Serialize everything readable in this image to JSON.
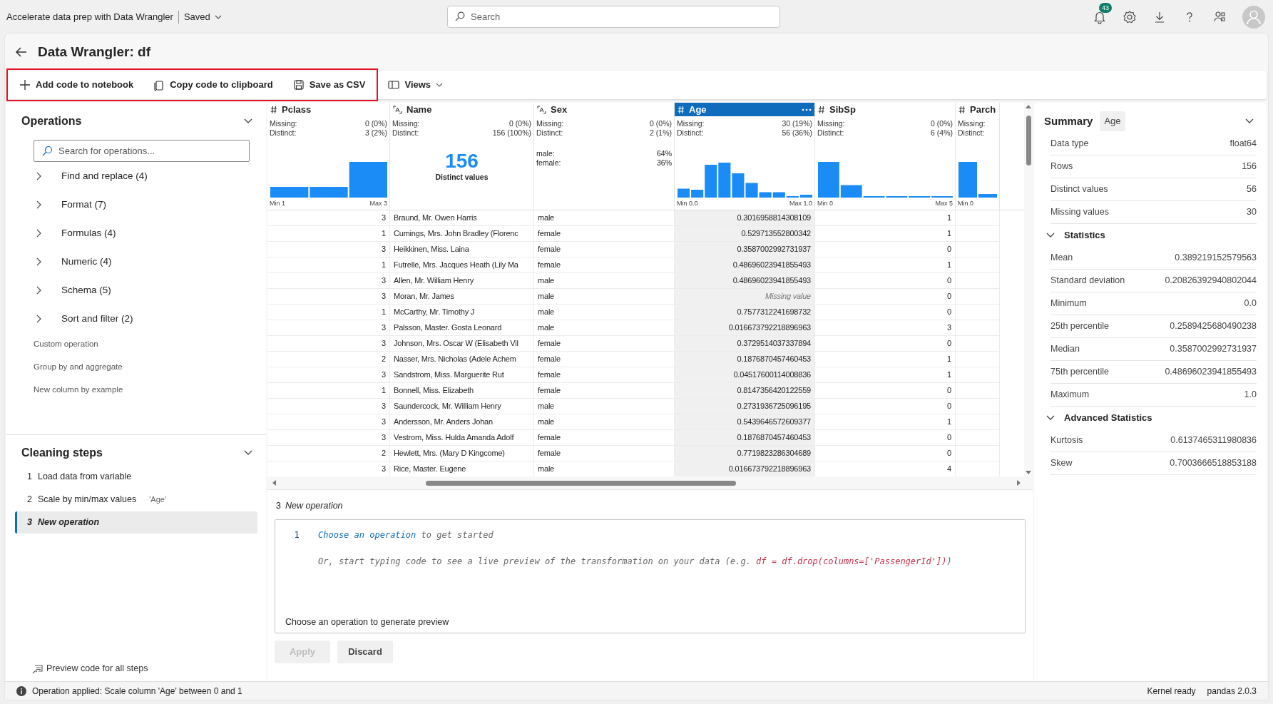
{
  "top_bar": {
    "title": "Accelerate data prep with Data Wrangler",
    "save_state": "Saved",
    "search_placeholder": "Search",
    "notification_count": "43"
  },
  "header": {
    "title": "Data Wrangler: df"
  },
  "toolbar": {
    "highlighted": [
      {
        "kind": "add",
        "label": "Add code to notebook"
      },
      {
        "kind": "copy",
        "label": "Copy code to clipboard"
      },
      {
        "kind": "save",
        "label": "Save as CSV"
      }
    ],
    "other": [
      {
        "kind": "views",
        "label": "Views"
      }
    ]
  },
  "operations": {
    "title": "Operations",
    "expanded": true,
    "search_placeholder": "Search for operations...",
    "items": [
      {
        "kind": "group",
        "label": "Find and replace (4)",
        "expanded": false
      },
      {
        "kind": "group",
        "label": "Format (7)",
        "expanded": false
      },
      {
        "kind": "group",
        "label": "Formulas (4)",
        "expanded": false
      },
      {
        "kind": "group",
        "label": "Numeric (4)",
        "expanded": false
      },
      {
        "kind": "group",
        "label": "Schema (5)",
        "expanded": false
      },
      {
        "kind": "group",
        "label": "Sort and filter (2)",
        "expanded": false
      },
      {
        "kind": "action",
        "label": "Custom operation"
      },
      {
        "kind": "action",
        "label": "Group by and aggregate"
      },
      {
        "kind": "action",
        "label": "New column by example"
      }
    ]
  },
  "cleaning_steps": {
    "title": "Cleaning steps",
    "expanded": true,
    "steps": [
      {
        "number": "1",
        "label": "Load data from variable",
        "selected": false
      },
      {
        "number": "2",
        "label": "Scale by min/max values",
        "tag": "'Age'",
        "selected": false
      },
      {
        "number": "3",
        "label": "New operation",
        "selected": true
      }
    ],
    "preview_link": "Preview code for all steps"
  },
  "table": {
    "columns": [
      {
        "name": "Pclass",
        "kind": "number",
        "selected": false,
        "stats": [
          {
            "label": "Missing:",
            "value": "0 (0%)"
          },
          {
            "label": "Distinct:",
            "value": "3 (2%)"
          }
        ],
        "min": "Min 1",
        "max": "Max 3"
      },
      {
        "name": "Name",
        "kind": "text",
        "selected": false,
        "stats": [
          {
            "label": "Missing:",
            "value": "0 (0%)"
          },
          {
            "label": "Distinct:",
            "value": "156 (100%)"
          }
        ],
        "distinct_count": "156",
        "distinct_caption": "Distinct values"
      },
      {
        "name": "Sex",
        "kind": "text",
        "selected": false,
        "stats": [
          {
            "label": "Missing:",
            "value": "0 (0%)"
          },
          {
            "label": "Distinct:",
            "value": "2 (1%)"
          }
        ],
        "categories": [
          {
            "label": "male:",
            "value": "64%"
          },
          {
            "label": "female:",
            "value": "36%"
          }
        ]
      },
      {
        "name": "Age",
        "kind": "number",
        "selected": true,
        "stats": [
          {
            "label": "Missing:",
            "value": "30 (19%)"
          },
          {
            "label": "Distinct:",
            "value": "56 (36%)"
          }
        ],
        "min": "Min 0.0",
        "max": "Max 1.0"
      },
      {
        "name": "SibSp",
        "kind": "number",
        "selected": false,
        "stats": [
          {
            "label": "Missing:",
            "value": "0 (0%)"
          },
          {
            "label": "Distinct:",
            "value": "6 (4%)"
          }
        ],
        "min": "Min 0",
        "max": "Max 5"
      },
      {
        "name": "Parch",
        "kind": "number",
        "selected": false,
        "stats": [
          {
            "label": "Missing:"
          },
          {
            "label": "Distinct:"
          }
        ],
        "min": "Min 0"
      }
    ],
    "rows": [
      {
        "cells": [
          "3",
          "Braund, Mr. Owen Harris",
          "male",
          "0.3016958814308109",
          "1"
        ],
        "missing": [
          false,
          false,
          false,
          false,
          false
        ]
      },
      {
        "cells": [
          "1",
          "Cumings, Mrs. John Bradley (Florenc",
          "female",
          "0.529713552800342",
          "1"
        ],
        "missing": [
          false,
          false,
          false,
          false,
          false
        ]
      },
      {
        "cells": [
          "3",
          "Heikkinen, Miss. Laina",
          "female",
          "0.3587002992731937",
          "0"
        ],
        "missing": [
          false,
          false,
          false,
          false,
          false
        ]
      },
      {
        "cells": [
          "1",
          "Futrelle, Mrs. Jacques Heath (Lily Ma",
          "female",
          "0.48696023941855493",
          "1"
        ],
        "missing": [
          false,
          false,
          false,
          false,
          false
        ]
      },
      {
        "cells": [
          "3",
          "Allen, Mr. William Henry",
          "male",
          "0.48696023941855493",
          "0"
        ],
        "missing": [
          false,
          false,
          false,
          false,
          false
        ]
      },
      {
        "cells": [
          "3",
          "Moran, Mr. James",
          "male",
          "Missing value",
          "0"
        ],
        "missing": [
          false,
          false,
          false,
          true,
          false
        ]
      },
      {
        "cells": [
          "1",
          "McCarthy, Mr. Timothy J",
          "male",
          "0.7577312241698732",
          "0"
        ],
        "missing": [
          false,
          false,
          false,
          false,
          false
        ]
      },
      {
        "cells": [
          "3",
          "Palsson, Master. Gosta Leonard",
          "male",
          "0.016673792218896963",
          "3"
        ],
        "missing": [
          false,
          false,
          false,
          false,
          false
        ]
      },
      {
        "cells": [
          "3",
          "Johnson, Mrs. Oscar W (Elisabeth Vil",
          "female",
          "0.3729514037337894",
          "0"
        ],
        "missing": [
          false,
          false,
          false,
          false,
          false
        ]
      },
      {
        "cells": [
          "2",
          "Nasser, Mrs. Nicholas (Adele Achem",
          "female",
          "0.1876870457460453",
          "1"
        ],
        "missing": [
          false,
          false,
          false,
          false,
          false
        ]
      },
      {
        "cells": [
          "3",
          "Sandstrom, Miss. Marguerite Rut",
          "female",
          "0.04517600114008836",
          "1"
        ],
        "missing": [
          false,
          false,
          false,
          false,
          false
        ]
      },
      {
        "cells": [
          "1",
          "Bonnell, Miss. Elizabeth",
          "female",
          "0.8147356420122559",
          "0"
        ],
        "missing": [
          false,
          false,
          false,
          false,
          false
        ]
      },
      {
        "cells": [
          "3",
          "Saundercock, Mr. William Henry",
          "male",
          "0.2731936725096195",
          "0"
        ],
        "missing": [
          false,
          false,
          false,
          false,
          false
        ]
      },
      {
        "cells": [
          "3",
          "Andersson, Mr. Anders Johan",
          "male",
          "0.5439646572609377",
          "1"
        ],
        "missing": [
          false,
          false,
          false,
          false,
          false
        ]
      },
      {
        "cells": [
          "3",
          "Vestrom, Miss. Hulda Amanda Adolf",
          "female",
          "0.1876870457460453",
          "0"
        ],
        "missing": [
          false,
          false,
          false,
          false,
          false
        ]
      },
      {
        "cells": [
          "2",
          "Hewlett, Mrs. (Mary D Kingcome)",
          "female",
          "0.7719823286304689",
          "0"
        ],
        "missing": [
          false,
          false,
          false,
          false,
          false
        ]
      },
      {
        "cells": [
          "3",
          "Rice, Master. Eugene",
          "male",
          "0.016673792218896963",
          "4"
        ],
        "missing": [
          false,
          false,
          false,
          false,
          false
        ]
      }
    ]
  },
  "code_panel": {
    "step_number": "3",
    "step_label": "New operation",
    "line_number": "1",
    "link": "Choose an operation",
    "line_rest": "to get started",
    "hint_prefix": "Or, start typing code to see a live preview of the transformation on your data (e.g.",
    "hint_code": "df = df.drop(columns=['PassengerId'])",
    "hint_suffix": ")",
    "preview_message": "Choose an operation to generate preview",
    "buttons": [
      {
        "label": "Apply",
        "disabled": true
      },
      {
        "label": "Discard",
        "disabled": false
      }
    ]
  },
  "summary": {
    "title": "Summary",
    "column_tag": "Age",
    "expanded": true,
    "rows": [
      {
        "label": "Data type",
        "value": "float64"
      },
      {
        "label": "Rows",
        "value": "156"
      },
      {
        "label": "Distinct values",
        "value": "56"
      },
      {
        "label": "Missing values",
        "value": "30"
      }
    ],
    "sections": [
      {
        "title": "Statistics",
        "expanded": true,
        "rows": [
          {
            "label": "Mean",
            "value": "0.389219152579563"
          },
          {
            "label": "Standard deviation",
            "value": "0.20826392940802044"
          },
          {
            "label": "Minimum",
            "value": "0.0"
          },
          {
            "label": "25th percentile",
            "value": "0.2589425680490238"
          },
          {
            "label": "Median",
            "value": "0.3587002992731937"
          },
          {
            "label": "75th percentile",
            "value": "0.48696023941855493"
          },
          {
            "label": "Maximum",
            "value": "1.0"
          }
        ]
      },
      {
        "title": "Advanced Statistics",
        "expanded": true,
        "rows": [
          {
            "label": "Kurtosis",
            "value": "0.6137465311980836"
          },
          {
            "label": "Skew",
            "value": "0.7003666518853188"
          }
        ]
      }
    ]
  },
  "status_bar": {
    "message": "Operation applied: Scale column 'Age' between 0 and 1",
    "kernel": "Kernel ready",
    "version": "pandas 2.0.3"
  }
}
